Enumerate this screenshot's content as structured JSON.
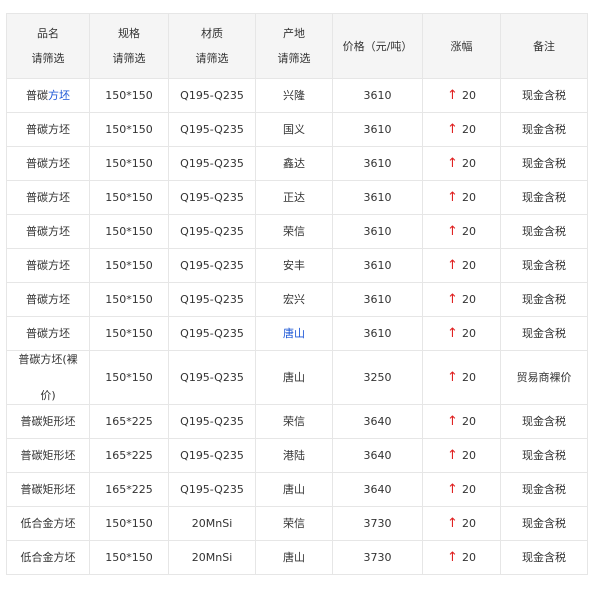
{
  "columns": [
    {
      "label": "品名",
      "filter": "请筛选"
    },
    {
      "label": "规格",
      "filter": "请筛选"
    },
    {
      "label": "材质",
      "filter": "请筛选"
    },
    {
      "label": "产地",
      "filter": "请筛选"
    },
    {
      "label": "价格（元/吨）",
      "filter": ""
    },
    {
      "label": "涨幅",
      "filter": ""
    },
    {
      "label": "备注",
      "filter": ""
    }
  ],
  "up_arrow": "↑",
  "rows": [
    {
      "name_prefix": "普碳",
      "name_suffix": "方坯",
      "spec": "150*150",
      "material": "Q195-Q235",
      "origin": "兴隆",
      "price": "3610",
      "change": "20",
      "note": "现金含税"
    },
    {
      "name_prefix": "普碳方坯",
      "name_suffix": "",
      "spec": "150*150",
      "material": "Q195-Q235",
      "origin": "国义",
      "price": "3610",
      "change": "20",
      "note": "现金含税"
    },
    {
      "name_prefix": "普碳方坯",
      "name_suffix": "",
      "spec": "150*150",
      "material": "Q195-Q235",
      "origin": "鑫达",
      "price": "3610",
      "change": "20",
      "note": "现金含税"
    },
    {
      "name_prefix": "普碳方坯",
      "name_suffix": "",
      "spec": "150*150",
      "material": "Q195-Q235",
      "origin": "正达",
      "price": "3610",
      "change": "20",
      "note": "现金含税"
    },
    {
      "name_prefix": "普碳方坯",
      "name_suffix": "",
      "spec": "150*150",
      "material": "Q195-Q235",
      "origin": "荣信",
      "price": "3610",
      "change": "20",
      "note": "现金含税"
    },
    {
      "name_prefix": "普碳方坯",
      "name_suffix": "",
      "spec": "150*150",
      "material": "Q195-Q235",
      "origin": "安丰",
      "price": "3610",
      "change": "20",
      "note": "现金含税"
    },
    {
      "name_prefix": "普碳方坯",
      "name_suffix": "",
      "spec": "150*150",
      "material": "Q195-Q235",
      "origin": "宏兴",
      "price": "3610",
      "change": "20",
      "note": "现金含税"
    },
    {
      "name_prefix": "普碳方坯",
      "name_suffix": "",
      "spec": "150*150",
      "material": "Q195-Q235",
      "origin": "唐山",
      "price": "3610",
      "change": "20",
      "note": "现金含税"
    },
    {
      "name_prefix": "普碳方坯(裸",
      "name_suffix": "价)",
      "spec": "150*150",
      "material": "Q195-Q235",
      "origin": "唐山",
      "price": "3250",
      "change": "20",
      "note": "贸易商裸价"
    },
    {
      "name_prefix": "普碳矩形坯",
      "name_suffix": "",
      "spec": "165*225",
      "material": "Q195-Q235",
      "origin": "荣信",
      "price": "3640",
      "change": "20",
      "note": "现金含税"
    },
    {
      "name_prefix": "普碳矩形坯",
      "name_suffix": "",
      "spec": "165*225",
      "material": "Q195-Q235",
      "origin": "港陆",
      "price": "3640",
      "change": "20",
      "note": "现金含税"
    },
    {
      "name_prefix": "普碳矩形坯",
      "name_suffix": "",
      "spec": "165*225",
      "material": "Q195-Q235",
      "origin": "唐山",
      "price": "3640",
      "change": "20",
      "note": "现金含税"
    },
    {
      "name_prefix": "低合金方坯",
      "name_suffix": "",
      "spec": "150*150",
      "material": "20MnSi",
      "origin": "荣信",
      "price": "3730",
      "change": "20",
      "note": "现金含税"
    },
    {
      "name_prefix": "低合金方坯",
      "name_suffix": "",
      "spec": "150*150",
      "material": "20MnSi",
      "origin": "唐山",
      "price": "3730",
      "change": "20",
      "note": "现金含税"
    }
  ]
}
